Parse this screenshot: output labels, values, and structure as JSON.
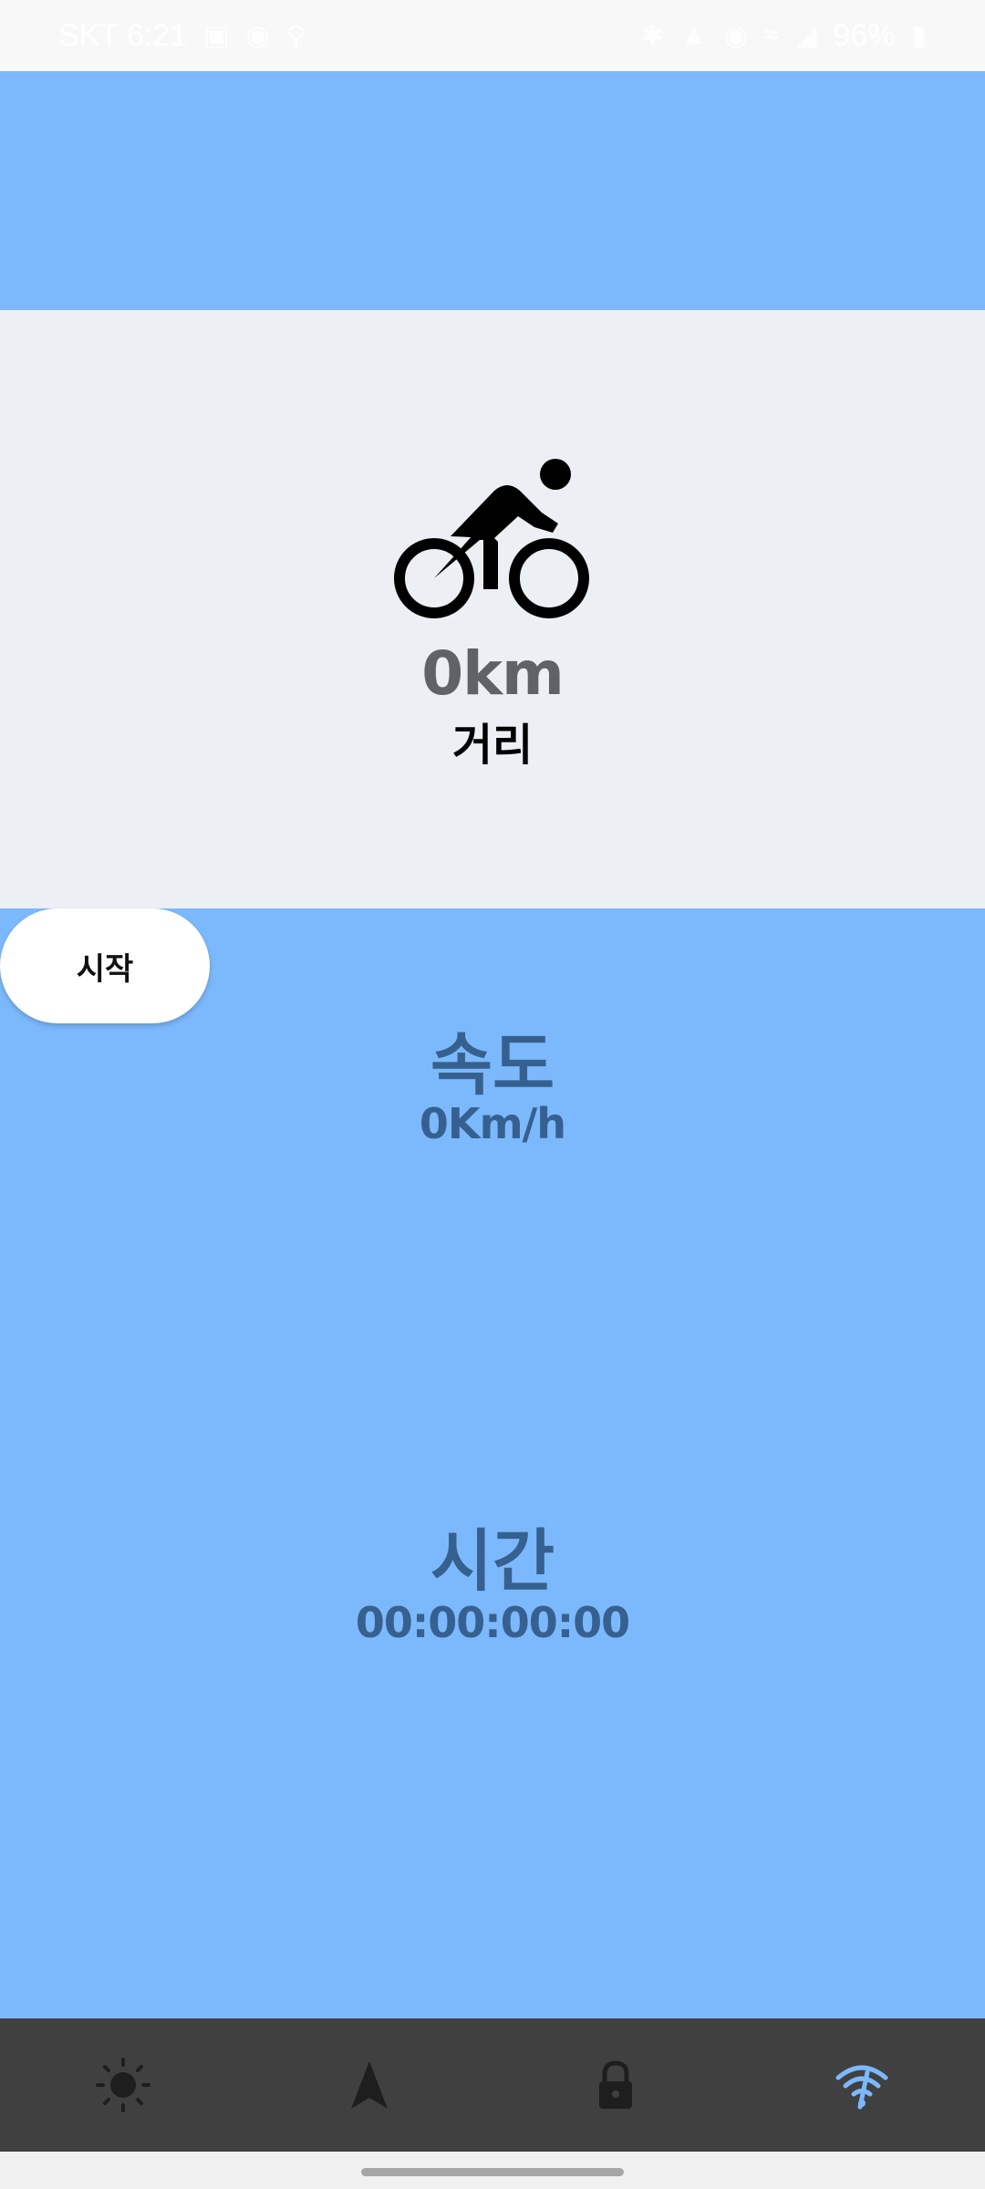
{
  "status_bar": {
    "carrier_time": "SKT 6:21",
    "battery": "96%",
    "left_icons": [
      "gallery-icon",
      "chat-icon",
      "location-pin-icon"
    ],
    "right_icons": [
      "bluetooth-icon",
      "lte-icon",
      "location-icon",
      "wifi-icon",
      "signal-icon",
      "battery-icon"
    ]
  },
  "distance": {
    "icon": "bike-icon",
    "value": "0km",
    "label": "거리"
  },
  "start_button": {
    "label": "시작"
  },
  "speed": {
    "title": "속도",
    "value": "0Km/h"
  },
  "time": {
    "title": "시간",
    "value": "00:00:00:00"
  },
  "bottom_nav": {
    "items": [
      {
        "icon": "brightness-icon",
        "active": false
      },
      {
        "icon": "navigation-arrow-icon",
        "active": false
      },
      {
        "icon": "lock-icon",
        "active": false
      },
      {
        "icon": "wifi-off-icon",
        "active": true
      }
    ],
    "active_color": "#7cb9fc",
    "inactive_color": "#1e1e1e"
  },
  "colors": {
    "accent_blue": "#7cb9fc",
    "card_gray": "#ecf0f4",
    "metric_text": "#36608f",
    "nav_background": "#404040"
  }
}
